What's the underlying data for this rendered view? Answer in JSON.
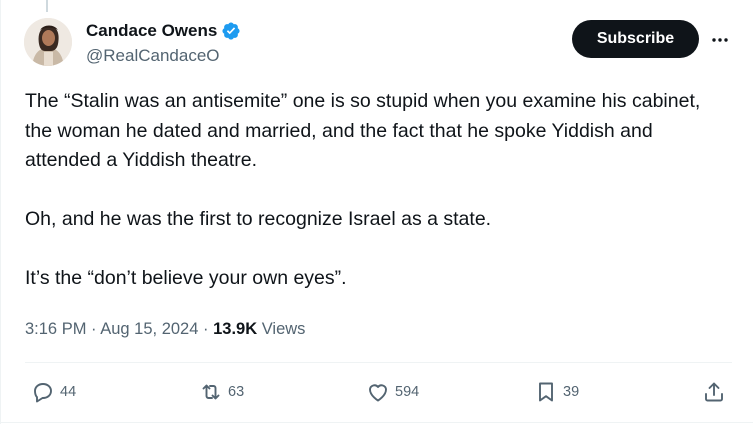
{
  "author": {
    "display_name": "Candace Owens",
    "handle": "@RealCandaceO",
    "verified": true,
    "verified_color": "#1d9bf0"
  },
  "header": {
    "subscribe_label": "Subscribe",
    "more_icon": "more-dots-icon"
  },
  "tweet": {
    "paragraphs": [
      "The “Stalin was an antisemite” one is so stupid when you examine his cabinet, the woman he dated and married, and the fact that he spoke Yiddish and attended a Yiddish theatre.",
      "Oh, and he was the first to recognize Israel as a state.",
      "It’s the “don’t believe your own eyes”."
    ]
  },
  "meta": {
    "time": "3:16 PM",
    "separator": "·",
    "date": "Aug 15, 2024",
    "views_count": "13.9K",
    "views_label": "Views"
  },
  "actions": {
    "reply": {
      "icon": "reply-icon",
      "count": "44"
    },
    "repost": {
      "icon": "repost-icon",
      "count": "63"
    },
    "like": {
      "icon": "heart-icon",
      "count": "594"
    },
    "bookmark": {
      "icon": "bookmark-icon",
      "count": "39"
    },
    "share": {
      "icon": "share-icon"
    }
  },
  "colors": {
    "text_primary": "#0f1419",
    "text_secondary": "#536471",
    "button_dark": "#0f1419",
    "divider": "#eff3f4"
  }
}
